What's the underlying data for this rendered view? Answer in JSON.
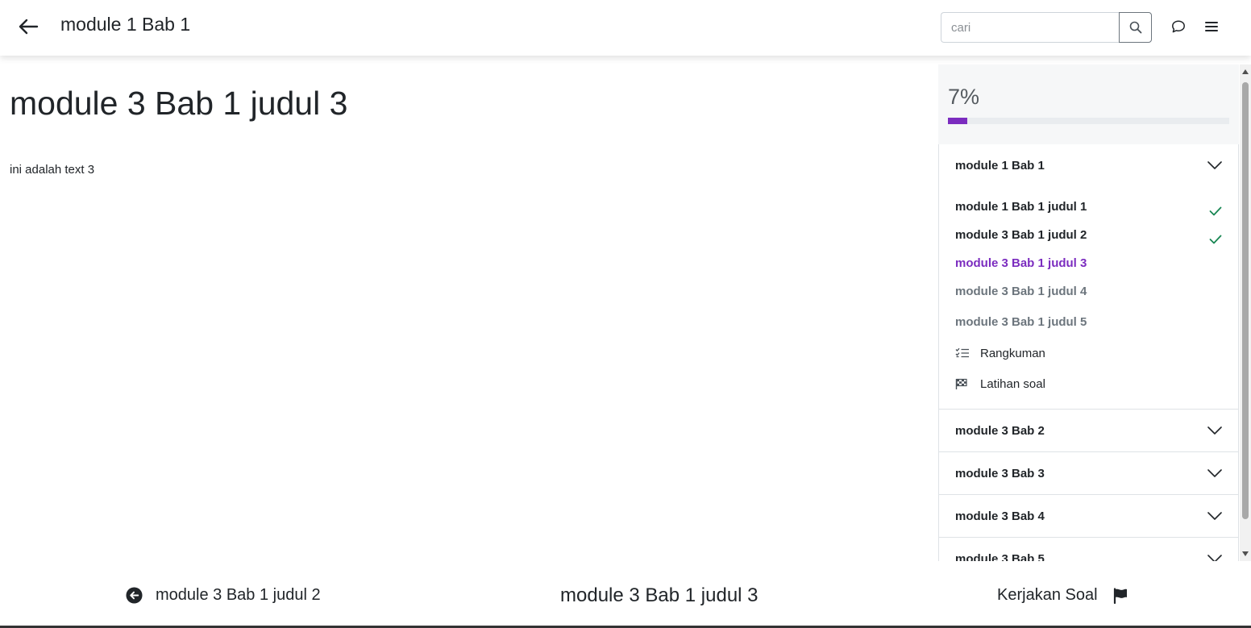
{
  "header": {
    "title": "module 1 Bab 1",
    "search_placeholder": "cari",
    "back_icon": "arrow-left-icon",
    "chat_icon": "chat-icon",
    "menu_icon": "hamburger-menu-icon"
  },
  "content": {
    "title": "module 3 Bab 1 judul 3",
    "text": "ini adalah text 3"
  },
  "sidebar": {
    "progress_label": "7%",
    "progress_value": 0.07,
    "accent_color": "#7b2cbf",
    "sections": [
      {
        "title": "module 1 Bab 1",
        "lessons": [
          {
            "label": "module 1 Bab 1 judul 1",
            "status": "done"
          },
          {
            "label": "module 3 Bab 1 judul 2",
            "status": "done"
          },
          {
            "label": "module 3 Bab 1 judul 3",
            "status": "active"
          },
          {
            "label": "module 3 Bab 1 judul 4",
            "status": "todo"
          },
          {
            "label": "module 3 Bab 1 judul 5",
            "status": "todo"
          }
        ],
        "summary_label": "Rangkuman",
        "exercise_label": "Latihan soal"
      },
      {
        "title": "module 3 Bab 2"
      },
      {
        "title": "module 3 Bab 3"
      },
      {
        "title": "module 3 Bab 4"
      },
      {
        "title": "module 3 Bab 5"
      }
    ]
  },
  "footer": {
    "prev_label": "module 3 Bab 1 judul 2",
    "current_label": "module 3 Bab 1 judul 3",
    "next_label": "Kerjakan Soal"
  }
}
